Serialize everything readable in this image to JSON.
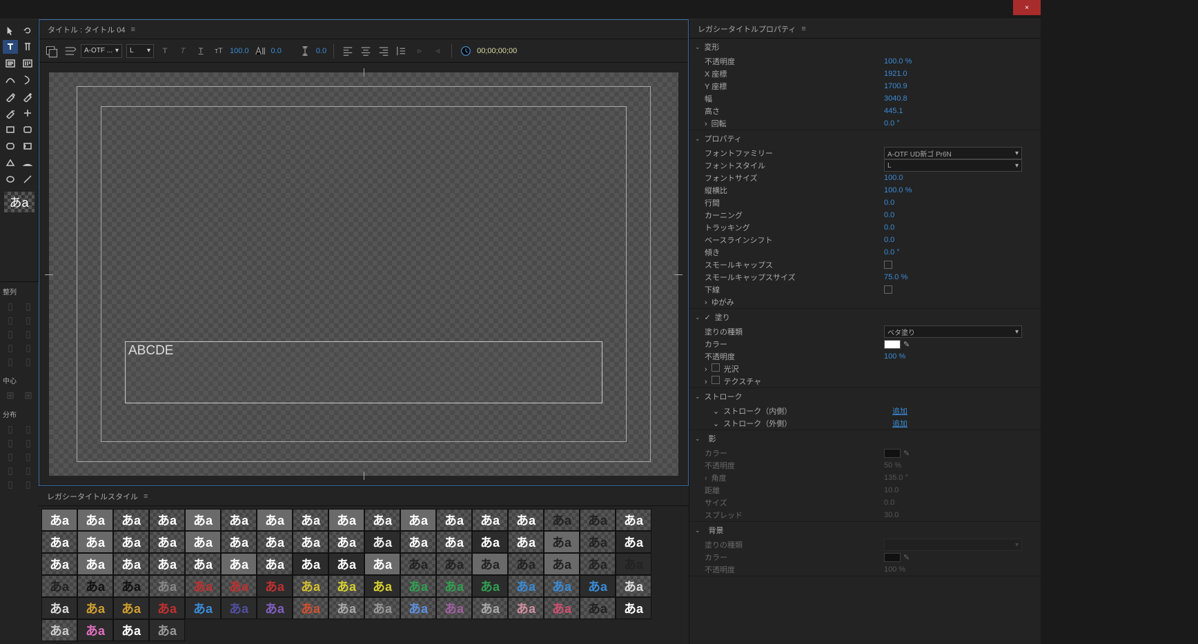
{
  "titlebar": {
    "close": "×"
  },
  "panel": {
    "title_tab": "タイトル : タイトル 04",
    "styles_tab": "レガシータイトルスタイル",
    "props_tab": "レガシータイトルプロパティ"
  },
  "toolbar": {
    "font_select": "A-OTF ...",
    "style_select": "L",
    "font_size": "100.0",
    "kerning": "0.0",
    "leading": "0.0",
    "timecode": "00;00;00;00"
  },
  "canvas": {
    "text": "ABCDE"
  },
  "align": {
    "hdr1": "整列",
    "hdr2": "中心",
    "hdr3": "分布"
  },
  "props": {
    "transform": {
      "hdr": "変形",
      "opacity_lbl": "不透明度",
      "opacity": "100.0 %",
      "x_lbl": "X 座標",
      "x": "1921.0",
      "y_lbl": "Y 座標",
      "y": "1700.9",
      "w_lbl": "幅",
      "w": "3040.8",
      "h_lbl": "高さ",
      "h": "445.1",
      "rot_lbl": "回転",
      "rot": "0.0 °"
    },
    "properties": {
      "hdr": "プロパティ",
      "family_lbl": "フォントファミリー",
      "family": "A-OTF UD新ゴ Pr6N",
      "style_lbl": "フォントスタイル",
      "style": "L",
      "size_lbl": "フォントサイズ",
      "size": "100.0",
      "aspect_lbl": "縦横比",
      "aspect": "100.0 %",
      "leading_lbl": "行間",
      "leading": "0.0",
      "kerning_lbl": "カーニング",
      "kerning": "0.0",
      "tracking_lbl": "トラッキング",
      "tracking": "0.0",
      "baseline_lbl": "ベースラインシフト",
      "baseline": "0.0",
      "slant_lbl": "傾き",
      "slant": "0.0 °",
      "smallcaps_lbl": "スモールキャップス",
      "smallcaps_size_lbl": "スモールキャップスサイズ",
      "smallcaps_size": "75.0 %",
      "underline_lbl": "下線",
      "distort_lbl": "ゆがみ"
    },
    "fill": {
      "hdr": "塗り",
      "type_lbl": "塗りの種類",
      "type": "ベタ塗り",
      "color_lbl": "カラー",
      "opacity_lbl": "不透明度",
      "opacity": "100 %",
      "sheen_lbl": "光沢",
      "texture_lbl": "テクスチャ"
    },
    "stroke": {
      "hdr": "ストローク",
      "inner_lbl": "ストローク（内側）",
      "inner_add": "追加",
      "outer_lbl": "ストローク（外側）",
      "outer_add": "追加"
    },
    "shadow": {
      "hdr": "影",
      "color_lbl": "カラー",
      "opacity_lbl": "不透明度",
      "opacity": "50 %",
      "angle_lbl": "角度",
      "angle": "135.0 °",
      "distance_lbl": "距離",
      "distance": "10.0",
      "size_lbl": "サイズ",
      "size": "0.0",
      "spread_lbl": "スプレッド",
      "spread": "30.0"
    },
    "bg": {
      "hdr": "背景",
      "type_lbl": "塗りの種類",
      "color_lbl": "カラー",
      "opacity_lbl": "不透明度",
      "opacity": "100 %"
    }
  },
  "style_swatches": [
    {
      "c": "#fff",
      "bg": "gray"
    },
    {
      "c": "#fff",
      "bg": "gray"
    },
    {
      "c": "#fff",
      "bg": "check"
    },
    {
      "c": "#fff",
      "bg": "check",
      "bold": true
    },
    {
      "c": "#fff",
      "bg": "gray"
    },
    {
      "c": "#fff",
      "bg": "check"
    },
    {
      "c": "#fff",
      "bg": "gray",
      "bold": true
    },
    {
      "c": "#fff",
      "bg": "check",
      "bold": true
    },
    {
      "c": "#fff",
      "bg": "gray",
      "bold": true
    },
    {
      "c": "#fff",
      "bg": "check",
      "bold": true
    },
    {
      "c": "#fff",
      "bg": "gray"
    },
    {
      "c": "#fff",
      "bg": "check"
    },
    {
      "c": "#fff",
      "bg": "check"
    },
    {
      "c": "#fff",
      "bg": "check"
    },
    {
      "c": "#222",
      "bg": "check",
      "bold": true
    },
    {
      "c": "#222",
      "bg": "check",
      "bold": true
    },
    {
      "c": "#fff",
      "bg": "check"
    },
    {
      "c": "#fff",
      "bg": "check",
      "bold": true
    },
    {
      "c": "#fff",
      "bg": "gray"
    },
    {
      "c": "#fff",
      "bg": "check",
      "bold": true
    },
    {
      "c": "#fff",
      "bg": "check",
      "bold": true
    },
    {
      "c": "#fff",
      "bg": "gray"
    },
    {
      "c": "#fff",
      "bg": "check",
      "bold": true
    },
    {
      "c": "#fff",
      "bg": "check"
    },
    {
      "c": "#fff",
      "bg": "check",
      "bold": true
    },
    {
      "c": "#fff",
      "bg": "check"
    },
    {
      "c": "#eee",
      "bg": "dark"
    },
    {
      "c": "#fff",
      "bg": "check"
    },
    {
      "c": "#fff",
      "bg": "check"
    },
    {
      "c": "#fff",
      "bg": "dark",
      "bold": true
    },
    {
      "c": "#fff",
      "bg": "check",
      "bold": true
    },
    {
      "c": "#222",
      "bg": "gray"
    },
    {
      "c": "#222",
      "bg": "check",
      "bold": true
    },
    {
      "c": "#fff",
      "bg": "dark"
    },
    {
      "c": "#fff",
      "bg": "check",
      "bold": true
    },
    {
      "c": "#fff",
      "bg": "gray"
    },
    {
      "c": "#fff",
      "bg": "check"
    },
    {
      "c": "#fff",
      "bg": "check"
    },
    {
      "c": "#fff",
      "bg": "check",
      "bold": true
    },
    {
      "c": "#fff",
      "bg": "gray",
      "bold": true
    },
    {
      "c": "#fff",
      "bg": "check",
      "bold": true
    },
    {
      "c": "#fff",
      "bg": "dark",
      "bold": true
    },
    {
      "c": "#fff",
      "bg": "dark",
      "bold": true
    },
    {
      "c": "#fff",
      "bg": "gray"
    },
    {
      "c": "#222",
      "bg": "check"
    },
    {
      "c": "#222",
      "bg": "check",
      "bold": true
    },
    {
      "c": "#222",
      "bg": "gray"
    },
    {
      "c": "#222",
      "bg": "check"
    },
    {
      "c": "#222",
      "bg": "gray",
      "bold": true
    },
    {
      "c": "#222",
      "bg": "check",
      "bold": true
    },
    {
      "c": "#222",
      "bg": "dark",
      "bold": true
    },
    {
      "c": "#222",
      "bg": "check",
      "bold": true
    },
    {
      "c": "#111",
      "bg": "check",
      "bold": true
    },
    {
      "c": "#111",
      "bg": "check",
      "bold": true
    },
    {
      "c": "#888",
      "bg": "check"
    },
    {
      "c": "#c03030",
      "bg": "check",
      "bold": true
    },
    {
      "c": "#c03030",
      "bg": "check",
      "bold": true
    },
    {
      "c": "#c03030",
      "bg": "dark",
      "bold": true
    },
    {
      "c": "#d6c030",
      "bg": "check",
      "bold": true
    },
    {
      "c": "#d6d030",
      "bg": "check",
      "bold": true
    },
    {
      "c": "#d6d030",
      "bg": "dark",
      "bold": true
    },
    {
      "c": "#30a050",
      "bg": "check",
      "bold": true
    },
    {
      "c": "#30a050",
      "bg": "check",
      "bold": true
    },
    {
      "c": "#30a050",
      "bg": "dark",
      "bold": true
    },
    {
      "c": "#3a8cd6",
      "bg": "check",
      "bold": true
    },
    {
      "c": "#3a8cd6",
      "bg": "check",
      "bold": true
    },
    {
      "c": "#3a8cd6",
      "bg": "dark",
      "bold": true
    },
    {
      "c": "#ddd",
      "bg": "check",
      "bold": true
    },
    {
      "c": "#ddd",
      "bg": "dark",
      "bold": true
    },
    {
      "c": "#d0a030",
      "bg": "dark",
      "bold": true
    },
    {
      "c": "#d0a030",
      "bg": "dark",
      "bold": true
    },
    {
      "c": "#c03030",
      "bg": "dark",
      "bold": true
    },
    {
      "c": "#3a8cd6",
      "bg": "dark",
      "bold": true
    },
    {
      "c": "#5050a0",
      "bg": "dark",
      "bold": true
    },
    {
      "c": "#8060c0",
      "bg": "dark",
      "bold": true
    },
    {
      "c": "#d05030",
      "bg": "check",
      "bold": true
    },
    {
      "c": "#aaa",
      "bg": "check",
      "bold": true
    },
    {
      "c": "#999",
      "bg": "check"
    },
    {
      "c": "#6090e0",
      "bg": "check",
      "bold": true
    },
    {
      "c": "#a060a0",
      "bg": "check",
      "bold": true
    },
    {
      "c": "#aaa",
      "bg": "check"
    },
    {
      "c": "#d090a0",
      "bg": "check",
      "bold": true
    },
    {
      "c": "#d05070",
      "bg": "check",
      "bold": true
    },
    {
      "c": "#222",
      "bg": "check",
      "bold": true
    },
    {
      "c": "#fff",
      "bg": "dark"
    },
    {
      "c": "#ccc",
      "bg": "check"
    },
    {
      "c": "#e070c0",
      "bg": "dark",
      "bold": true
    },
    {
      "c": "#fff",
      "bg": "dark",
      "bold": true
    },
    {
      "c": "#999",
      "bg": "dark"
    }
  ]
}
